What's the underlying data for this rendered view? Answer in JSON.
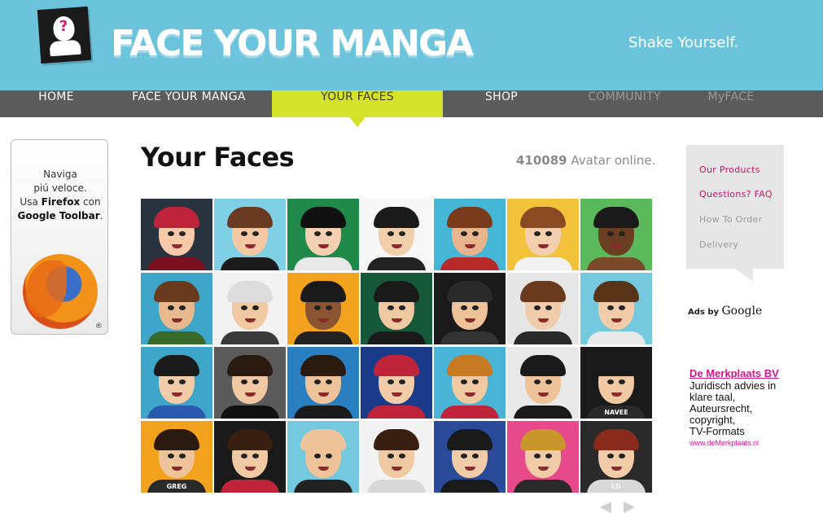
{
  "header": {
    "brand": "FACE YOUR MANGA",
    "tagline": "Shake Yourself."
  },
  "nav": [
    {
      "label": "HOME",
      "state": "normal"
    },
    {
      "label": "FACE YOUR MANGA",
      "state": "normal"
    },
    {
      "label": "YOUR FACES",
      "state": "active"
    },
    {
      "label": "SHOP",
      "state": "normal"
    },
    {
      "label": "COMMUNITY",
      "state": "muted"
    },
    {
      "label": "MyFACE",
      "state": "muted"
    }
  ],
  "promo": {
    "line1": "Naviga",
    "line2": "piú veloce.",
    "line3_prefix": "Usa ",
    "line3_bold": "Firefox",
    "line3_suffix": " con",
    "line4_bold": "Google Toolbar",
    "line4_suffix": ".",
    "icon": "firefox-logo-icon"
  },
  "main": {
    "title": "Your Faces",
    "count_number": "410089",
    "count_label": " Avatar online."
  },
  "avatars": [
    {
      "bg": "#2a3340",
      "skin": "#f6c9a8",
      "hair": "#c0243a",
      "shirt": "#7a1020",
      "label": ""
    },
    {
      "bg": "#7fd0e4",
      "skin": "#f3c8a3",
      "hair": "#6b3a22",
      "shirt": "#1b1b1b",
      "label": ""
    },
    {
      "bg": "#1f8a4a",
      "skin": "#f4d0b2",
      "hair": "#111111",
      "shirt": "#e8e8e8",
      "label": ""
    },
    {
      "bg": "#f7f7f7",
      "skin": "#f1cfaa",
      "hair": "#1a1a1a",
      "shirt": "#222222",
      "label": ""
    },
    {
      "bg": "#46b6d6",
      "skin": "#e8b48c",
      "hair": "#7a3a1c",
      "shirt": "#b82a2a",
      "label": ""
    },
    {
      "bg": "#f2c23a",
      "skin": "#f3cfae",
      "hair": "#8a4a22",
      "shirt": "#f2f2f2",
      "label": ""
    },
    {
      "bg": "#5ab95a",
      "skin": "#6b3e22",
      "hair": "#1a1a1a",
      "shirt": "#7a4a2a",
      "label": ""
    },
    {
      "bg": "#3ea6c8",
      "skin": "#e8b88e",
      "hair": "#6a3a1c",
      "shirt": "#3a6a2a",
      "label": ""
    },
    {
      "bg": "#f2f2f2",
      "skin": "#f0c8a2",
      "hair": "#dcdcdc",
      "shirt": "#3a3a3a",
      "label": ""
    },
    {
      "bg": "#f2a21c",
      "skin": "#8a5530",
      "hair": "#1a1a1a",
      "shirt": "#222222",
      "label": ""
    },
    {
      "bg": "#16593a",
      "skin": "#f0c8a2",
      "hair": "#1a1a1a",
      "shirt": "#1a1a1a",
      "label": ""
    },
    {
      "bg": "#1a1a1a",
      "skin": "#eec39a",
      "hair": "#2a2a2a",
      "shirt": "#333333",
      "label": ""
    },
    {
      "bg": "#e6e6e6",
      "skin": "#f1ccab",
      "hair": "#6a3a1c",
      "shirt": "#2a2a2a",
      "label": ""
    },
    {
      "bg": "#74c9df",
      "skin": "#f2cca8",
      "hair": "#5a3418",
      "shirt": "#e8e8e8",
      "label": ""
    },
    {
      "bg": "#3ea6c8",
      "skin": "#f2cca8",
      "hair": "#1a1a1a",
      "shirt": "#2a5ab0",
      "label": ""
    },
    {
      "bg": "#5a5a5a",
      "skin": "#f0c8a2",
      "hair": "#2a1a10",
      "shirt": "#111111",
      "label": ""
    },
    {
      "bg": "#2a7fc0",
      "skin": "#eec39a",
      "hair": "#2a1a10",
      "shirt": "#1a1a1a",
      "label": ""
    },
    {
      "bg": "#1a3a8a",
      "skin": "#f2cca8",
      "hair": "#c0243a",
      "shirt": "#c0243a",
      "label": ""
    },
    {
      "bg": "#4ab4d6",
      "skin": "#f0c8a2",
      "hair": "#c87a22",
      "shirt": "#c0243a",
      "label": ""
    },
    {
      "bg": "#e8e8e8",
      "skin": "#eec39a",
      "hair": "#1a1a1a",
      "shirt": "#1a1a1a",
      "label": ""
    },
    {
      "bg": "#1a1a1a",
      "skin": "#f0c8a2",
      "hair": "#1a1a1a",
      "shirt": "#2a2a2a",
      "label": "NAVEE"
    },
    {
      "bg": "#f2a21c",
      "skin": "#eec39a",
      "hair": "#2a1a10",
      "shirt": "#2a2a2a",
      "label": "GREG"
    },
    {
      "bg": "#1a1a1a",
      "skin": "#f0c8a2",
      "hair": "#3a2010",
      "shirt": "#c0243a",
      "label": ""
    },
    {
      "bg": "#74c9df",
      "skin": "#eec39a",
      "hair": "#eec39a",
      "shirt": "#222222",
      "label": ""
    },
    {
      "bg": "#f2f2f2",
      "skin": "#f0c8a2",
      "hair": "#3a2010",
      "shirt": "#d8d8d8",
      "label": ""
    },
    {
      "bg": "#2a4a9a",
      "skin": "#f2cca8",
      "hair": "#1a1a1a",
      "shirt": "#1a1a1a",
      "label": ""
    },
    {
      "bg": "#e64a8a",
      "skin": "#f2cca8",
      "hair": "#c8962a",
      "shirt": "#2a2a2a",
      "label": ""
    },
    {
      "bg": "#2a2a2a",
      "skin": "#f2cca8",
      "hair": "#8a2a1a",
      "shirt": "#d8d8d8",
      "label": "LD"
    }
  ],
  "side_menu": [
    {
      "label": "Our Products",
      "style": "pink"
    },
    {
      "label": "Questions? FAQ",
      "style": "pink"
    },
    {
      "label": "How To Order",
      "style": "grey"
    },
    {
      "label": "Delivery",
      "style": "grey"
    }
  ],
  "ads": {
    "ads_by": "Ads by ",
    "google": "Google",
    "ad_title": "De Merkplaats BV",
    "ad_line1": "Juridisch advies in",
    "ad_line2": "klare taal,",
    "ad_line3": "Auteursrecht,",
    "ad_line4": "copyright,",
    "ad_line5": "TV-Formats",
    "ad_url": "www.deMerkplaats.nl"
  },
  "colors": {
    "header_bg": "#6cc4dc",
    "nav_bg": "#5c5c5c",
    "nav_active": "#d4e22a",
    "accent_pink": "#c8126a"
  }
}
